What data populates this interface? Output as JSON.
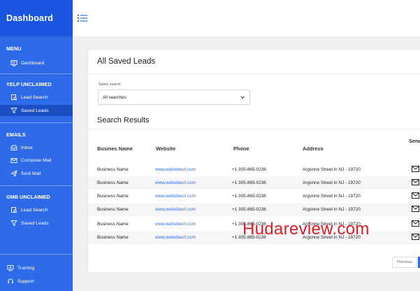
{
  "sidebar": {
    "title": "Dashboard",
    "sections": [
      {
        "label": "MENU",
        "items": [
          {
            "label": "Dashboard",
            "icon": "dashboard-icon"
          }
        ]
      },
      {
        "label": "YELP UNCLAIMED",
        "items": [
          {
            "label": "Lead Search",
            "icon": "search-icon"
          },
          {
            "label": "Saved Leads",
            "icon": "filter-icon",
            "active": true
          }
        ]
      },
      {
        "label": "EMAILS",
        "items": [
          {
            "label": "Inbox",
            "icon": "inbox-icon"
          },
          {
            "label": "Compose Mail",
            "icon": "compose-icon"
          },
          {
            "label": "Sent Mail",
            "icon": "send-icon"
          }
        ]
      },
      {
        "label": "GMB UNCLAIMED",
        "items": [
          {
            "label": "Lead Search",
            "icon": "search-icon"
          },
          {
            "label": "Saved Leads",
            "icon": "filter-icon"
          }
        ]
      }
    ],
    "footer": [
      {
        "label": "Training",
        "icon": "training-icon"
      },
      {
        "label": "Support",
        "icon": "support-icon"
      }
    ]
  },
  "topbar": {
    "menu_icon": "hamburger-icon"
  },
  "main": {
    "title": "All Saved Leads",
    "select_label": "Select search:",
    "select_value": "All searches",
    "results_title": "Search Results",
    "columns": [
      "Busines Name",
      "Website",
      "Phone",
      "Address",
      "Send Email"
    ],
    "rows": [
      {
        "name": "Business Name",
        "website": "www.websiteurl.com",
        "phone": "+1 305-865-0236",
        "address": "Argonne Street in NJ - 19720"
      },
      {
        "name": "Business Name",
        "website": "www.websiteurl.com",
        "phone": "+1 305-865-0236",
        "address": "Argonne Street in NJ - 19720"
      },
      {
        "name": "Business Name",
        "website": "www.websiteurl.com",
        "phone": "+1 305-865-0236",
        "address": "Argonne Street in NJ - 19720"
      },
      {
        "name": "Business Name",
        "website": "www.websiteurl.com",
        "phone": "+1 305-865-0236",
        "address": "Argonne Street in NJ - 19720"
      },
      {
        "name": "Business Name",
        "website": "www.websiteurl.com",
        "phone": "+1 305-865-0236",
        "address": "Argonne Street in NJ - 19720"
      },
      {
        "name": "Business Name",
        "website": "www.websiteurl.com",
        "phone": "+1 305-865-0236",
        "address": "Argonne Street in NJ - 19720"
      }
    ],
    "prev_label": "Previous"
  },
  "watermark": "Hudareview.com",
  "colors": {
    "sidebar": "#2f6be8",
    "sidebar_header": "#1a56df",
    "active_item": "#1d4fc4",
    "link": "#2f6be8",
    "watermark": "#e01c24"
  }
}
